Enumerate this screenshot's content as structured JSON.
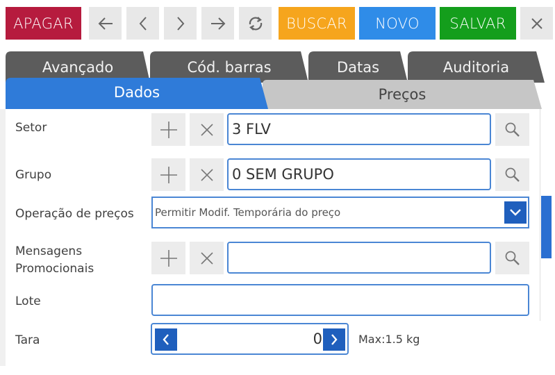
{
  "toolbar": {
    "delete_label": "APAGAR",
    "search_label": "BUSCAR",
    "new_label": "NOVO",
    "save_label": "SALVAR",
    "colors": {
      "delete": "#b61b3e",
      "search": "#f6a51d",
      "new": "#2f8ce8",
      "save": "#149e1c",
      "icon_buttons": "#e8e8e8"
    }
  },
  "tabs": {
    "advanced": "Avançado",
    "barcode": "Cód. barras",
    "dates": "Datas",
    "audit": "Auditoria",
    "data": "Dados",
    "prices": "Preços",
    "active_tab": "Dados",
    "colors": {
      "active": "#2f7bd9",
      "inactive": "#5c5c5c",
      "middle": "#bfbfbf"
    }
  },
  "form": {
    "sector": {
      "label": "Setor",
      "value": "3 FLV"
    },
    "group": {
      "label": "Grupo",
      "value": "0 SEM GRUPO"
    },
    "price_operation": {
      "label": "Operação de preços",
      "selected": "Permitir Modif. Temporária do preço"
    },
    "promo_messages": {
      "label_line1": "Mensagens",
      "label_line2": "Promocionais",
      "value": ""
    },
    "batch": {
      "label": "Lote",
      "value": ""
    },
    "tare": {
      "label": "Tara",
      "value": "0",
      "max_note": "Max:1.5 kg"
    }
  },
  "icons": {
    "add": "plus-icon",
    "clear": "close-icon",
    "search": "magnifier-icon",
    "dropdown": "chevron-down-icon",
    "decrement": "chevron-left-icon",
    "increment": "chevron-right-icon"
  }
}
